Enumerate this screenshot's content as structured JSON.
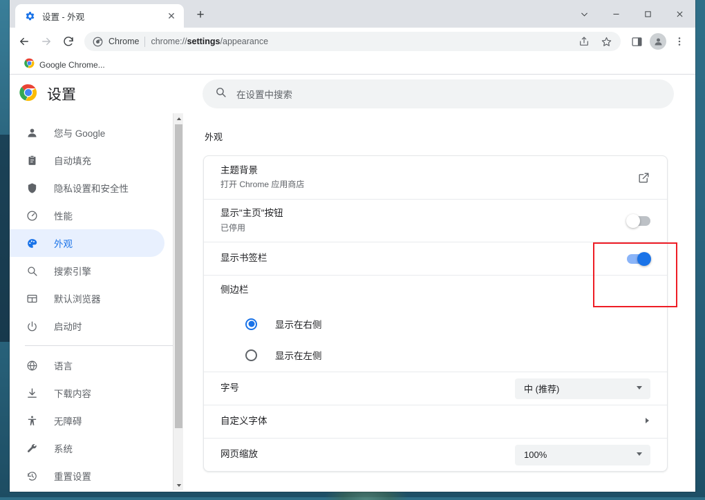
{
  "window": {
    "controls": [
      {
        "name": "chevron-down",
        "glyph": "v"
      },
      {
        "name": "minimize",
        "glyph": "–"
      },
      {
        "name": "maximize",
        "glyph": "□"
      },
      {
        "name": "close",
        "glyph": "×"
      }
    ]
  },
  "tab": {
    "title": "设置 - 外观",
    "favicon": "gear-icon",
    "close_label": "✕",
    "newtab_label": "+"
  },
  "toolbar": {
    "back_label": "←",
    "forward_label": "→",
    "reload_label": "⟳",
    "omnibox": {
      "scheme_label": "Chrome",
      "url_prefix": "chrome://",
      "url_bold": "settings",
      "url_suffix": "/appearance"
    },
    "share_label": "share-icon",
    "bookmark_label": "star-icon",
    "side_panel_label": "side-panel-icon",
    "profile_label": "profile-avatar",
    "menu_label": "⋮"
  },
  "bookmarks": {
    "items": [
      {
        "label": "Google Chrome...",
        "icon": "chrome-icon"
      }
    ]
  },
  "settings": {
    "brand_title": "设置",
    "search_placeholder": "在设置中搜索",
    "section_title": "外观",
    "sidebar": [
      {
        "label": "您与 Google",
        "icon": "person-icon",
        "active": false
      },
      {
        "label": "自动填充",
        "icon": "clipboard-icon",
        "active": false
      },
      {
        "label": "隐私设置和安全性",
        "icon": "shield-icon",
        "active": false
      },
      {
        "label": "性能",
        "icon": "speedometer-icon",
        "active": false
      },
      {
        "label": "外观",
        "icon": "palette-icon",
        "active": true
      },
      {
        "label": "搜索引擎",
        "icon": "search-icon",
        "active": false
      },
      {
        "label": "默认浏览器",
        "icon": "browser-window-icon",
        "active": false
      },
      {
        "label": "启动时",
        "icon": "power-icon",
        "active": false
      }
    ],
    "sidebar_group2": [
      {
        "label": "语言",
        "icon": "globe-icon",
        "active": false
      },
      {
        "label": "下载内容",
        "icon": "download-icon",
        "active": false
      },
      {
        "label": "无障碍",
        "icon": "accessibility-icon",
        "active": false
      },
      {
        "label": "系统",
        "icon": "wrench-icon",
        "active": false
      },
      {
        "label": "重置设置",
        "icon": "history-icon",
        "active": false
      }
    ],
    "rows": {
      "theme": {
        "label": "主题背景",
        "sublabel": "打开 Chrome 应用商店",
        "control": "external-link-icon"
      },
      "home_button": {
        "label": "显示\"主页\"按钮",
        "sublabel": "已停用",
        "toggle_state": "off"
      },
      "bookmarks_bar": {
        "label": "显示书签栏",
        "toggle_state": "on"
      },
      "side_panel": {
        "label": "侧边栏",
        "options": [
          {
            "label": "显示在右侧",
            "selected": true
          },
          {
            "label": "显示在左侧",
            "selected": false
          }
        ]
      },
      "font_size": {
        "label": "字号",
        "value": "中 (推荐)"
      },
      "custom_fonts": {
        "label": "自定义字体",
        "control": "chevron-right-icon"
      },
      "page_zoom": {
        "label": "网页缩放",
        "value": "100%"
      }
    }
  },
  "colors": {
    "accent": "#1a73e8",
    "toggle_on_track": "#8ab4f8",
    "toggle_off": "#bdc1c6",
    "highlight": "#ee1c25",
    "active_nav_bg": "#e8f0fe"
  }
}
